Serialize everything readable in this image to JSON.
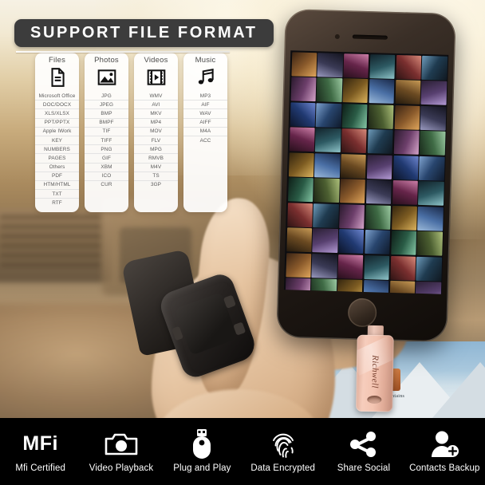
{
  "header": {
    "title": "SUPPORT FILE FORMAT"
  },
  "format_cards": [
    {
      "title": "Files",
      "icon": "document-icon",
      "formats": [
        "Microsoft Office",
        "DOC/DOCX",
        "XLS/XLSX",
        "PPT/PPTX",
        "Apple IWork",
        "KEY",
        "NUMBERS",
        "PAGES",
        "Others",
        "PDF",
        "HTM/HTML",
        "TXT",
        "RTF"
      ]
    },
    {
      "title": "Photos",
      "icon": "image-icon",
      "formats": [
        "JPG",
        "JPEG",
        "BMP",
        "BMPF",
        "TIF",
        "TIFF",
        "PNG",
        "GIF",
        "XBM",
        "ICO",
        "CUR"
      ]
    },
    {
      "title": "Videos",
      "icon": "film-icon",
      "formats": [
        "WMV",
        "AVI",
        "MKV",
        "MP4",
        "MOV",
        "FLV",
        "MPG",
        "RMVB",
        "M4V",
        "TS",
        "3GP"
      ]
    },
    {
      "title": "Music",
      "icon": "music-note-icon",
      "formats": [
        "MP3",
        "AIF",
        "WAV",
        "AIFF",
        "M4A",
        "ACC"
      ]
    }
  ],
  "product": {
    "brand": "Richwell",
    "color_hex": "#f0bfae"
  },
  "wallpaper": {
    "app_label": "Mountains"
  },
  "features": [
    {
      "icon": "mfi-text-icon",
      "text": "MFi",
      "label": "Mfi Certified"
    },
    {
      "icon": "camera-icon",
      "label": "Video Playback"
    },
    {
      "icon": "usb-drive-icon",
      "label": "Plug and Play"
    },
    {
      "icon": "fingerprint-icon",
      "label": "Data Encrypted"
    },
    {
      "icon": "share-icon",
      "label": "Share Social"
    },
    {
      "icon": "add-contact-icon",
      "label": "Contacts Backup"
    }
  ],
  "theme": {
    "bar_background": "#000000",
    "badge_background": "#3c3c3c",
    "card_background": "#ffffff",
    "text_on_dark": "#ffffff"
  }
}
